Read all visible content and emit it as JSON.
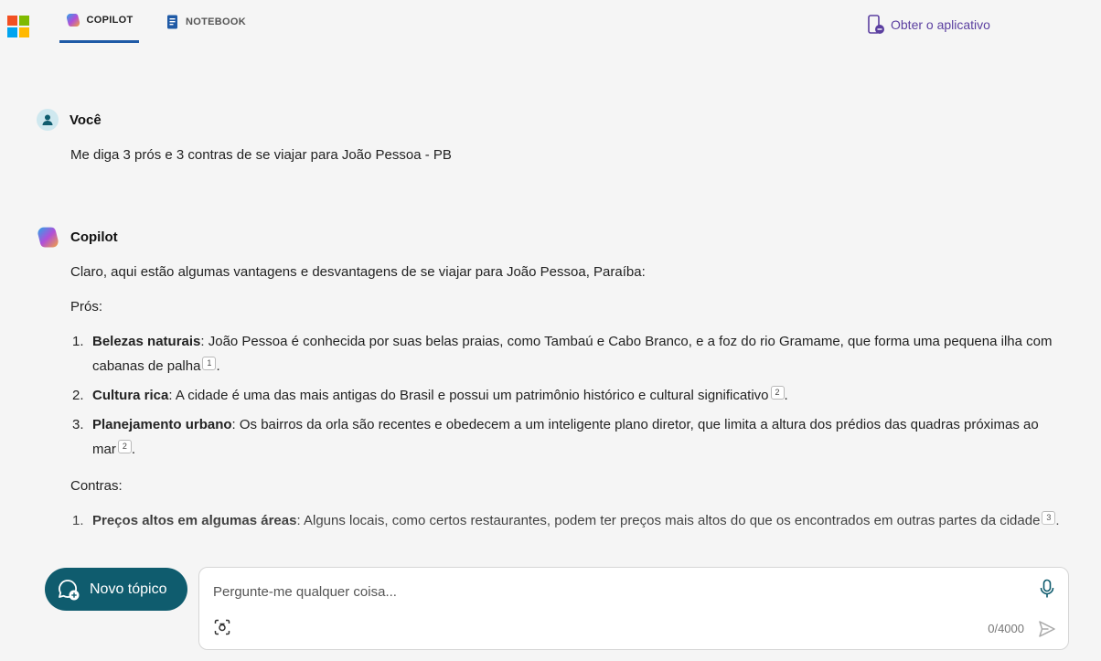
{
  "header": {
    "tabs": [
      {
        "label": "COPILOT",
        "icon": "copilot-icon",
        "active": true
      },
      {
        "label": "NOTEBOOK",
        "icon": "notebook-icon",
        "active": false
      }
    ],
    "get_app_label": "Obter o aplicativo"
  },
  "user_message": {
    "author": "Você",
    "text": "Me diga 3 prós e 3 contras de se viajar para João Pessoa - PB"
  },
  "copilot_message": {
    "author": "Copilot",
    "intro": "Claro, aqui estão algumas vantagens e desvantagens de se viajar para João Pessoa, Paraíba:",
    "pros_heading": "Prós:",
    "pros": [
      {
        "num": "1.",
        "title": "Belezas naturais",
        "text": ": João Pessoa é conhecida por suas belas praias, como Tambaú e Cabo Branco, e a foz do rio Gramame, que forma uma pequena ilha com cabanas de palha",
        "cite": "1",
        "end": "."
      },
      {
        "num": "2.",
        "title": "Cultura rica",
        "text": ": A cidade é uma das mais antigas do Brasil e possui um patrimônio histórico e cultural significativo",
        "cite": "2",
        "end": "."
      },
      {
        "num": "3.",
        "title": "Planejamento urbano",
        "text": ": Os bairros da orla são recentes e obedecem a um inteligente plano diretor, que limita a altura dos prédios das quadras próximas ao mar",
        "cite": "2",
        "end": "."
      }
    ],
    "cons_heading": "Contras:",
    "cons": [
      {
        "num": "1.",
        "title": "Preços altos em algumas áreas",
        "text": ": Alguns locais, como certos restaurantes, podem ter preços mais altos do que os encontrados em outras partes da cidade",
        "cite": "3",
        "end": "."
      }
    ]
  },
  "new_topic_label": "Novo tópico",
  "input": {
    "placeholder": "Pergunte-me qualquer coisa...",
    "value": "",
    "counter": "0/4000"
  },
  "colors": {
    "accent": "#0f5c6e",
    "tab_underline": "#1f5aa6",
    "get_app": "#5b3fa0"
  }
}
